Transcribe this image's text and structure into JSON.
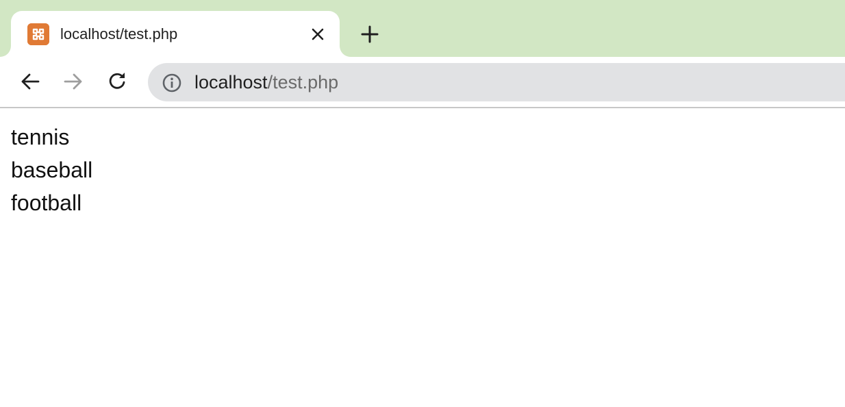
{
  "browser": {
    "tab": {
      "title": "localhost/test.php",
      "favicon": "xampp-logo-icon"
    },
    "new_tab_icon": "plus-icon",
    "close_icon": "close-icon",
    "address_bar": {
      "host": "localhost",
      "path": "/test.php",
      "security_icon": "info-icon"
    },
    "nav": {
      "back_icon": "arrow-left-icon",
      "forward_icon": "arrow-right-icon",
      "reload_icon": "reload-icon"
    },
    "colors": {
      "tabbar_bg": "#d2e7c4",
      "omnibox_bg": "#e1e2e4",
      "favicon_bg": "#e07a35"
    }
  },
  "page": {
    "lines": [
      "tennis",
      "baseball",
      "football"
    ]
  }
}
